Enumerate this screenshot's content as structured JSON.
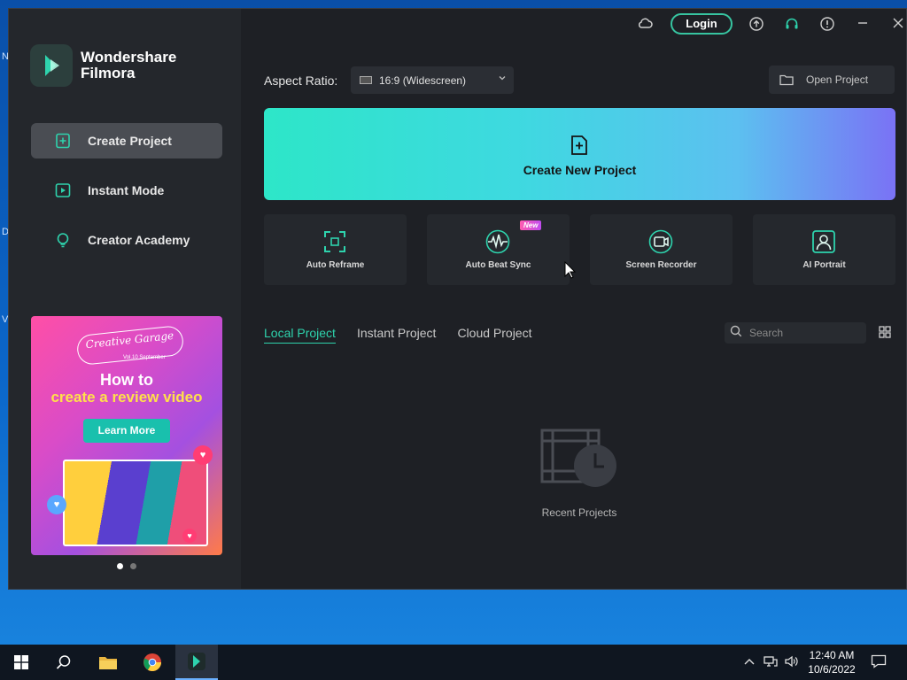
{
  "desktop": {
    "edge_letters": [
      "N",
      "D",
      "V"
    ]
  },
  "app": {
    "brand_line1": "Wondershare",
    "brand_line2": "Filmora",
    "accent_color": "#2ed3ad"
  },
  "titlebar": {
    "login_label": "Login",
    "icons": [
      "cloud-icon",
      "upload-icon",
      "headset-icon",
      "alert-icon",
      "minimize-icon",
      "close-icon"
    ]
  },
  "sidebar": {
    "items": [
      {
        "label": "Create Project",
        "icon": "add-file-icon",
        "active": true
      },
      {
        "label": "Instant Mode",
        "icon": "instant-mode-icon",
        "active": false
      },
      {
        "label": "Creator Academy",
        "icon": "lightbulb-icon",
        "active": false
      }
    ],
    "banner": {
      "brand": "Creative Garage",
      "brand_sub": "Vol.10 September",
      "headline1": "How to",
      "headline2": "create a review video",
      "cta": "Learn More"
    }
  },
  "aspect": {
    "label": "Aspect Ratio:",
    "selected": "16:9 (Widescreen)"
  },
  "open_project_label": "Open Project",
  "create_new_label": "Create New Project",
  "tools": [
    {
      "label": "Auto Reframe",
      "icon": "reframe-icon",
      "badge": ""
    },
    {
      "label": "Auto Beat Sync",
      "icon": "beat-sync-icon",
      "badge": "New"
    },
    {
      "label": "Screen Recorder",
      "icon": "screen-recorder-icon",
      "badge": ""
    },
    {
      "label": "AI Portrait",
      "icon": "ai-portrait-icon",
      "badge": ""
    }
  ],
  "project_tabs": [
    {
      "label": "Local Project",
      "active": true
    },
    {
      "label": "Instant Project",
      "active": false
    },
    {
      "label": "Cloud Project",
      "active": false
    }
  ],
  "search": {
    "placeholder": "Search"
  },
  "empty_state": {
    "label": "Recent Projects"
  },
  "taskbar": {
    "time": "12:40 AM",
    "date": "10/6/2022"
  }
}
